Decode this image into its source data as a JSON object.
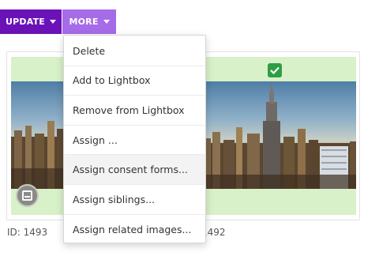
{
  "toolbar": {
    "update_label": "UPDATE",
    "more_label": "MORE"
  },
  "colors": {
    "update_bg": "#6a12b8",
    "more_bg": "#a56be8",
    "selected_band": "#d8f1c8",
    "check_green": "#2e9e45"
  },
  "menu": {
    "items": [
      {
        "label": "Delete"
      },
      {
        "label": "Add to Lightbox"
      },
      {
        "label": "Remove from Lightbox"
      },
      {
        "label": "Assign ..."
      },
      {
        "label": "Assign consent forms..."
      },
      {
        "label": "Assign siblings..."
      },
      {
        "label": "Assign related images..."
      }
    ],
    "hovered_index": 4
  },
  "cards": [
    {
      "id_label": "ID: 1493",
      "selected": false,
      "icon": "stack-icon"
    },
    {
      "id_label": "1492",
      "selected": true,
      "icon": "checkbox-checked-icon"
    }
  ]
}
